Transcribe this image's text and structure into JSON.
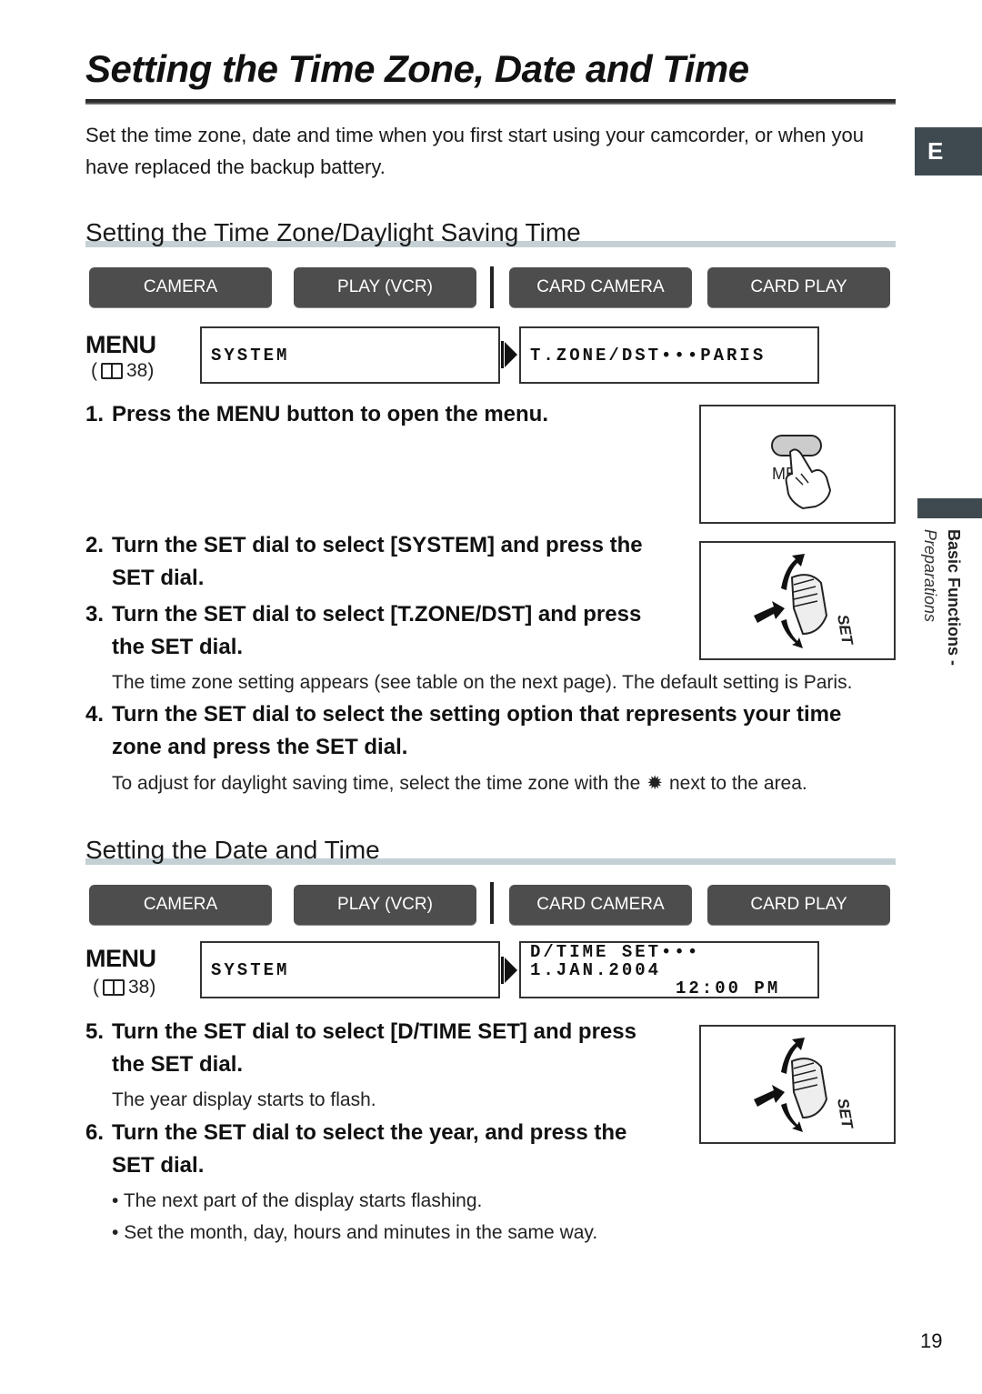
{
  "page": {
    "title": "Setting the Time Zone, Date and Time",
    "intro": "Set the time zone, date and time when you first start using your camcorder, or when you have replaced the backup battery.",
    "language_tab": "E",
    "side_label_bold": "Basic Functions -",
    "side_label_italic": "Preparations",
    "page_number": "19"
  },
  "section1": {
    "title": "Setting the Time Zone/Daylight Saving Time",
    "modes": [
      "CAMERA",
      "PLAY (VCR)",
      "CARD CAMERA",
      "CARD PLAY"
    ],
    "menu_logo": "MENU",
    "menu_ref_open": "(",
    "menu_ref_page": "38)",
    "lcd_left": "SYSTEM",
    "lcd_right_line1": "T.ZONE/DST•••PARIS",
    "steps": [
      {
        "num": "1.",
        "text": "Press the MENU button to open the menu."
      },
      {
        "num": "2.",
        "line1": "Turn the SET dial to select [SYSTEM] and press the",
        "line2": "SET dial."
      },
      {
        "num": "3.",
        "line1": "Turn the SET dial to select [T.ZONE/DST] and press",
        "line2": "the SET dial."
      },
      {
        "num": "4.",
        "line1": "Turn the SET dial to select the setting option that represents your time",
        "line2": "zone and press the SET dial."
      }
    ],
    "note_step3": "The time zone setting appears (see table on the next page). The default setting is Paris.",
    "note_step4_before": "To adjust for daylight saving time, select the time zone with the",
    "note_step4_after": "next to the area.",
    "illus_menu_label": "ME",
    "illus_set_label": "SET"
  },
  "section2": {
    "title": "Setting the Date and Time",
    "modes": [
      "CAMERA",
      "PLAY (VCR)",
      "CARD CAMERA",
      "CARD PLAY"
    ],
    "menu_logo": "MENU",
    "menu_ref_open": "(",
    "menu_ref_page": "38)",
    "lcd_left": "SYSTEM",
    "lcd_right_line1": "D/TIME SET••• 1.JAN.2004",
    "lcd_right_line2": "12:00 PM",
    "steps": [
      {
        "num": "5.",
        "line1": "Turn the SET dial to select [D/TIME SET] and press",
        "line2": "the SET dial."
      },
      {
        "num": "6.",
        "line1": "Turn the SET dial to select the year, and press the",
        "line2": "SET dial."
      }
    ],
    "note_step5": "The year display starts to flash.",
    "bullets": [
      "The next part of the display starts flashing.",
      "Set the month, day, hours and minutes in the same way."
    ],
    "illus_set_label": "SET"
  }
}
